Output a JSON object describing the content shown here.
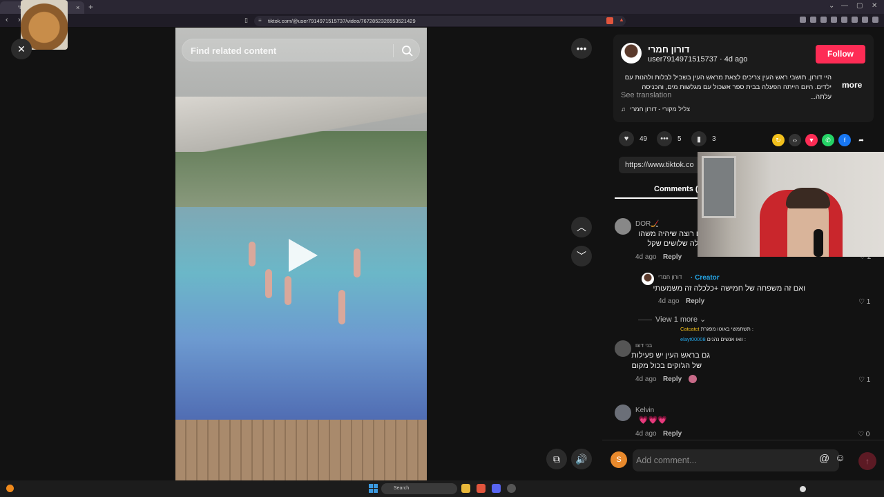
{
  "browser": {
    "tab_title": "וי",
    "tab_close": "×",
    "new_tab": "+",
    "url": "tiktok.com/@user7914971515737/video/7672852326553521429",
    "window_controls": [
      "⌄",
      "—",
      "▢",
      "✕"
    ]
  },
  "video": {
    "search_placeholder": "Find related content",
    "close_icon": "close-icon",
    "more_icon": "more-icon",
    "up_icon": "chevron-up-icon",
    "down_icon": "chevron-down-icon",
    "volume_icon": "volume-icon",
    "pip_icon": "pip-icon"
  },
  "author": {
    "name": "דורון חמרי",
    "handle": "user7914971515737 · 4d ago",
    "follow_label": "Follow",
    "description": "היי דורון, תושבי ראש העין צריכים לצאת מראש העין בשביל לבלות ולהנות עם ילדים. היום הייתה הפעלה בבית ספר אשכול עם מגלשות מים, והכניסה עלתה...",
    "more_label": "more",
    "see_translation": "See translation",
    "music": "צליל מקורי - דורון חמרי"
  },
  "actions": {
    "likes": "49",
    "comments": "5",
    "saves": "3",
    "link": "https://www.tiktok.co"
  },
  "tabs": {
    "comments_label": "Comments ("
  },
  "comments": [
    {
      "name": "DOR🏒",
      "lines": [
        "גם רוצה שיהיה משהו",
        "כולה שלושים שקל"
      ],
      "time": "4d ago",
      "reply": "Reply",
      "likes": "2"
    },
    {
      "name": "דורון חמרי",
      "badge": "Creator",
      "lines": [
        "ואם זה משפחה של חמישה +כלכלה זה משמעותי"
      ],
      "time": "4d ago",
      "reply": "Reply",
      "likes": "1"
    },
    {
      "name": "בני דוגו",
      "lines": [
        "גם בראש העין יש פעילות",
        "של הג'וקים בכול מקום"
      ],
      "time": "4d ago",
      "reply": "Reply",
      "likes": "1"
    },
    {
      "name": "Kelvin",
      "lines": [
        "💗💗💗"
      ],
      "time": "4d ago",
      "reply": "Reply",
      "likes": "0"
    }
  ],
  "view_more": "View 1 more ⌄",
  "reply_previews": [
    {
      "user": "Catcatct",
      "text": "תשתמשי באוטו מפגרת :"
    },
    {
      "user": "elayt00008",
      "text": "וואו אנשים נהנים :"
    }
  ],
  "composer": {
    "avatar_letter": "S",
    "placeholder": "Add comment...",
    "at": "@",
    "emoji": "☺",
    "send": "↑"
  },
  "taskbar": {
    "search_label": "Search"
  },
  "colors": {
    "follow": "#fe2c55",
    "creator": "#25a7e8",
    "panel": "#121212"
  }
}
